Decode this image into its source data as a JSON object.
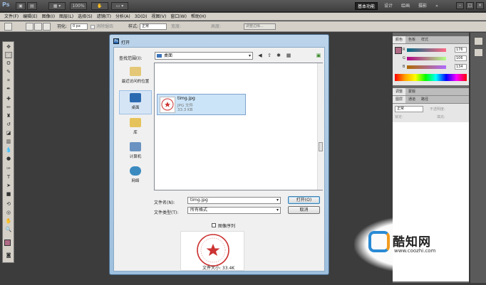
{
  "app": {
    "logo": "Ps",
    "zoom": "100%",
    "workspaces": [
      "基本功能",
      "设计",
      "绘画",
      "摄影",
      "»"
    ],
    "active_workspace": "基本功能"
  },
  "menu": [
    "文件(F)",
    "编辑(E)",
    "图像(I)",
    "图层(L)",
    "选择(S)",
    "滤镜(T)",
    "分析(A)",
    "3D(D)",
    "视图(V)",
    "窗口(W)",
    "帮助(H)"
  ],
  "options": {
    "feather_label": "羽化:",
    "feather_value": "0 px",
    "antialias_label": "消除锯齿",
    "style_label": "样式:",
    "style_value": "正常",
    "width_label": "宽度:",
    "height_label": "高度:",
    "refine_label": "调整边缘..."
  },
  "panels": {
    "color_tabs": [
      "颜色",
      "色板",
      "样式"
    ],
    "rgb": [
      {
        "letter": "R",
        "value": "176"
      },
      {
        "letter": "G",
        "value": "106"
      },
      {
        "letter": "B",
        "value": "134"
      }
    ],
    "adjust_tabs": [
      "调整",
      "蒙版"
    ],
    "layer_tabs": [
      "图层",
      "通道",
      "路径"
    ],
    "blend_mode": "正常",
    "opacity_label": "不透明度:",
    "fill_label": "填充:",
    "lock_label": "锁定:"
  },
  "dialog": {
    "title": "打开",
    "lookin_label": "查找范围(I):",
    "lookin_value": "桌面",
    "places": [
      "最近访问的位置",
      "桌面",
      "库",
      "计算机",
      "网络"
    ],
    "file": {
      "name": "timg.jpg",
      "type": "JPG 文件",
      "size": "33.3 KB"
    },
    "filename_label": "文件名(N):",
    "filename_value": "timg.jpg",
    "filetype_label": "文件类型(T):",
    "filetype_value": "所有格式",
    "open_button": "打开(O)",
    "cancel_button": "取消",
    "sequence_label": "图像序列",
    "filesize_text": "文件大小: 33.4K"
  },
  "watermark": {
    "name": "酷知网",
    "url": "www.coozhi.com"
  },
  "colors": {
    "foreground": "#b06a86",
    "accent": "#2a8ad4"
  }
}
